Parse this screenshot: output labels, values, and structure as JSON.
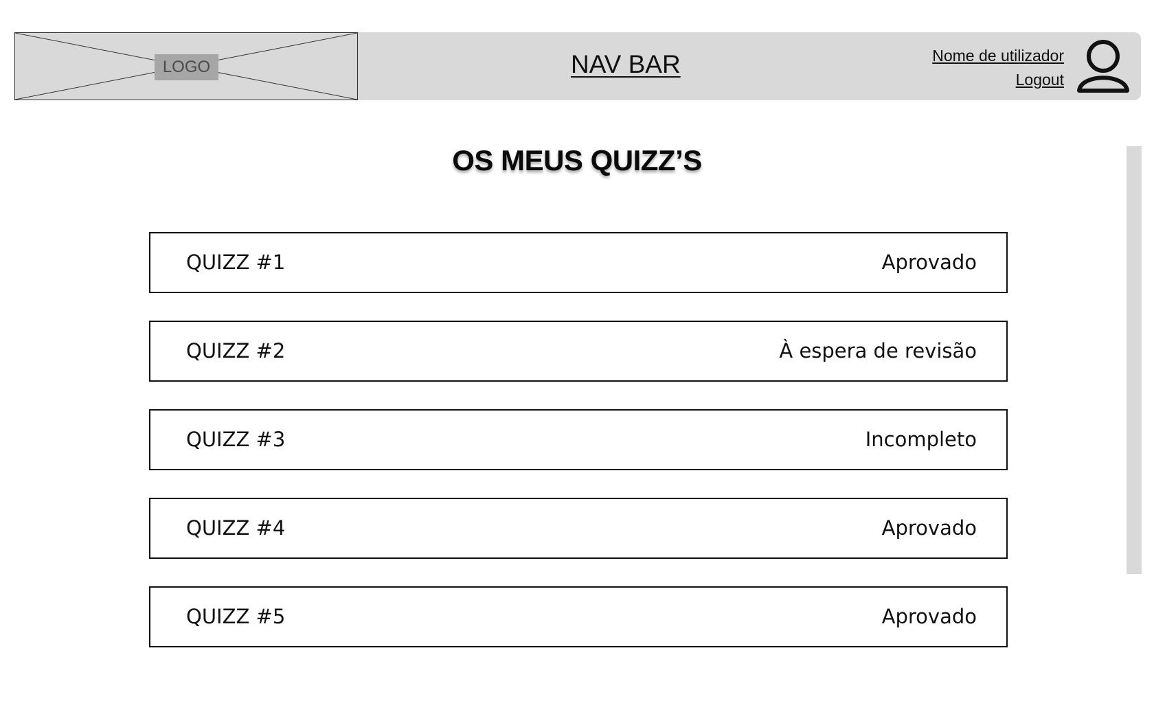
{
  "navbar": {
    "logo_label": "LOGO",
    "title": "NAV BAR",
    "user_name": "Nome de utilizador",
    "logout_label": "Logout",
    "avatar_icon": "user-icon",
    "background": "#d9d9d9"
  },
  "main": {
    "title": "OS MEUS QUIZZ’S",
    "quizzes": [
      {
        "name": "QUIZZ #1",
        "status": "Aprovado"
      },
      {
        "name": "QUIZZ #2",
        "status": "À espera de revisão"
      },
      {
        "name": "QUIZZ #3",
        "status": "Incompleto"
      },
      {
        "name": "QUIZZ #4",
        "status": "Aprovado"
      },
      {
        "name": "QUIZZ #5",
        "status": "Aprovado"
      }
    ]
  }
}
